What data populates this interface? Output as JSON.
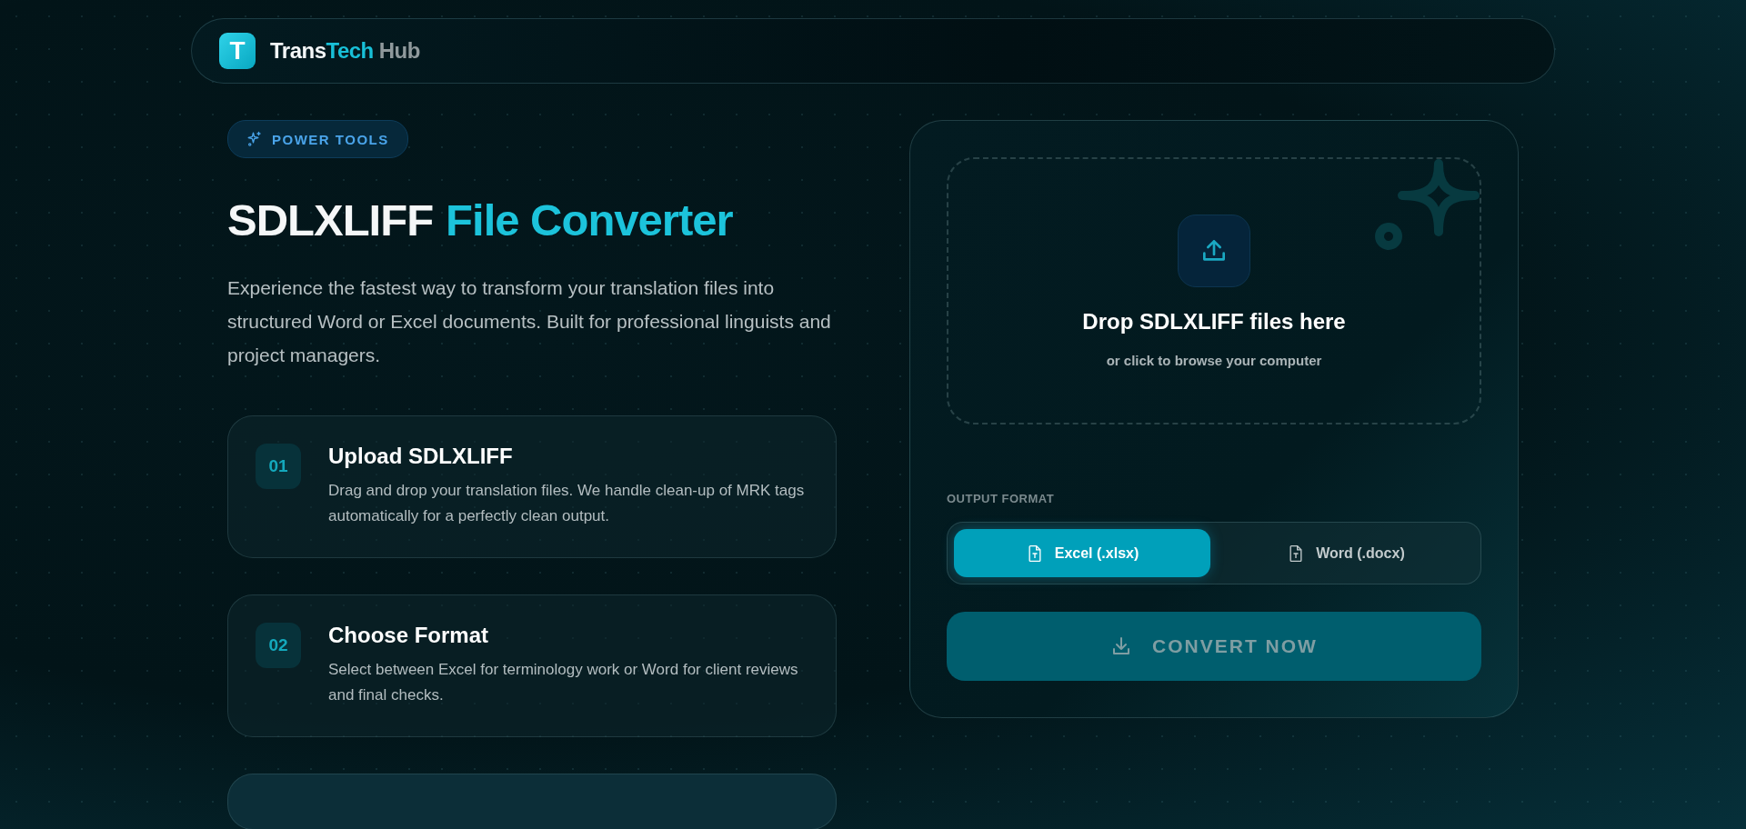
{
  "header": {
    "logo_letter": "T",
    "brand": [
      {
        "text": "Trans",
        "kind": "white"
      },
      {
        "text": "Tech",
        "kind": "accent"
      },
      {
        "text": "Hub",
        "kind": "muted"
      }
    ]
  },
  "hero": {
    "badge": "POWER TOOLS",
    "title": "SDLXLIFF",
    "title_accent": "File Converter",
    "description": "Experience the fastest way to transform your translation files into structured Word or Excel documents. Built for professional linguists and project managers."
  },
  "steps": [
    {
      "number": "01",
      "title": "Upload SDLXLIFF",
      "text": "Drag and drop your translation files. We handle clean-up of MRK tags automatically for a perfectly clean output."
    },
    {
      "number": "02",
      "title": "Choose Format",
      "text": "Select between Excel for terminology work or Word for client reviews and final checks."
    },
    {
      "kind": "cut"
    }
  ],
  "converter": {
    "dropzone": {
      "title": "Drop SDLXLIFF files here",
      "subtitle": "or click to browse your computer"
    },
    "output_label": "OUTPUT FORMAT",
    "formats": [
      {
        "label": "Excel (.xlsx)",
        "selected": true
      },
      {
        "label": "Word (.docx)",
        "selected": false
      }
    ],
    "convert_button": {
      "label": "CONVERT NOW",
      "disabled": true
    }
  }
}
